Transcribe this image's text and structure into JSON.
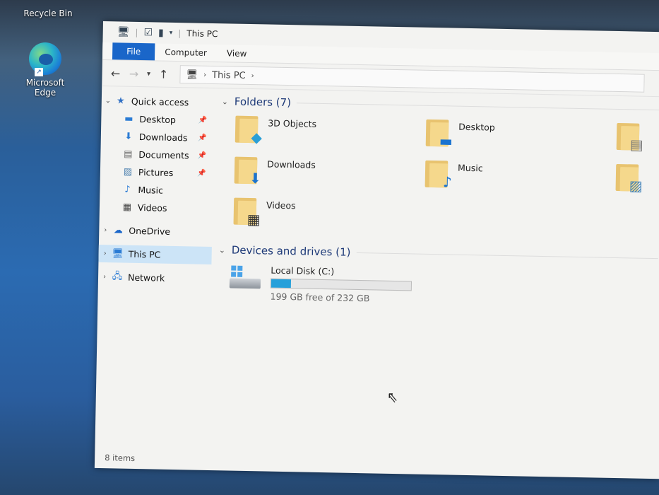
{
  "desktop": {
    "recycle_label": "Recycle Bin",
    "edge_label": "Microsoft Edge"
  },
  "window": {
    "title": "This PC",
    "ribbon_tabs": [
      "File",
      "Computer",
      "View"
    ],
    "address_path": "This PC"
  },
  "sidebar": {
    "quick_access": "Quick access",
    "pinned": [
      "Desktop",
      "Downloads",
      "Documents",
      "Pictures"
    ],
    "unpinned": [
      "Music",
      "Videos"
    ],
    "onedrive": "OneDrive",
    "this_pc": "This PC",
    "network": "Network"
  },
  "folders_header": "Folders (7)",
  "folders": [
    "3D Objects",
    "Desktop",
    "Downloads",
    "Music",
    "Videos"
  ],
  "devices_header": "Devices and drives (1)",
  "drive": {
    "name": "Local Disk (C:)",
    "free_text": "199 GB free of 232 GB",
    "used_fraction": 0.142
  },
  "status": "8 items",
  "accent_color": "#1a66c9"
}
